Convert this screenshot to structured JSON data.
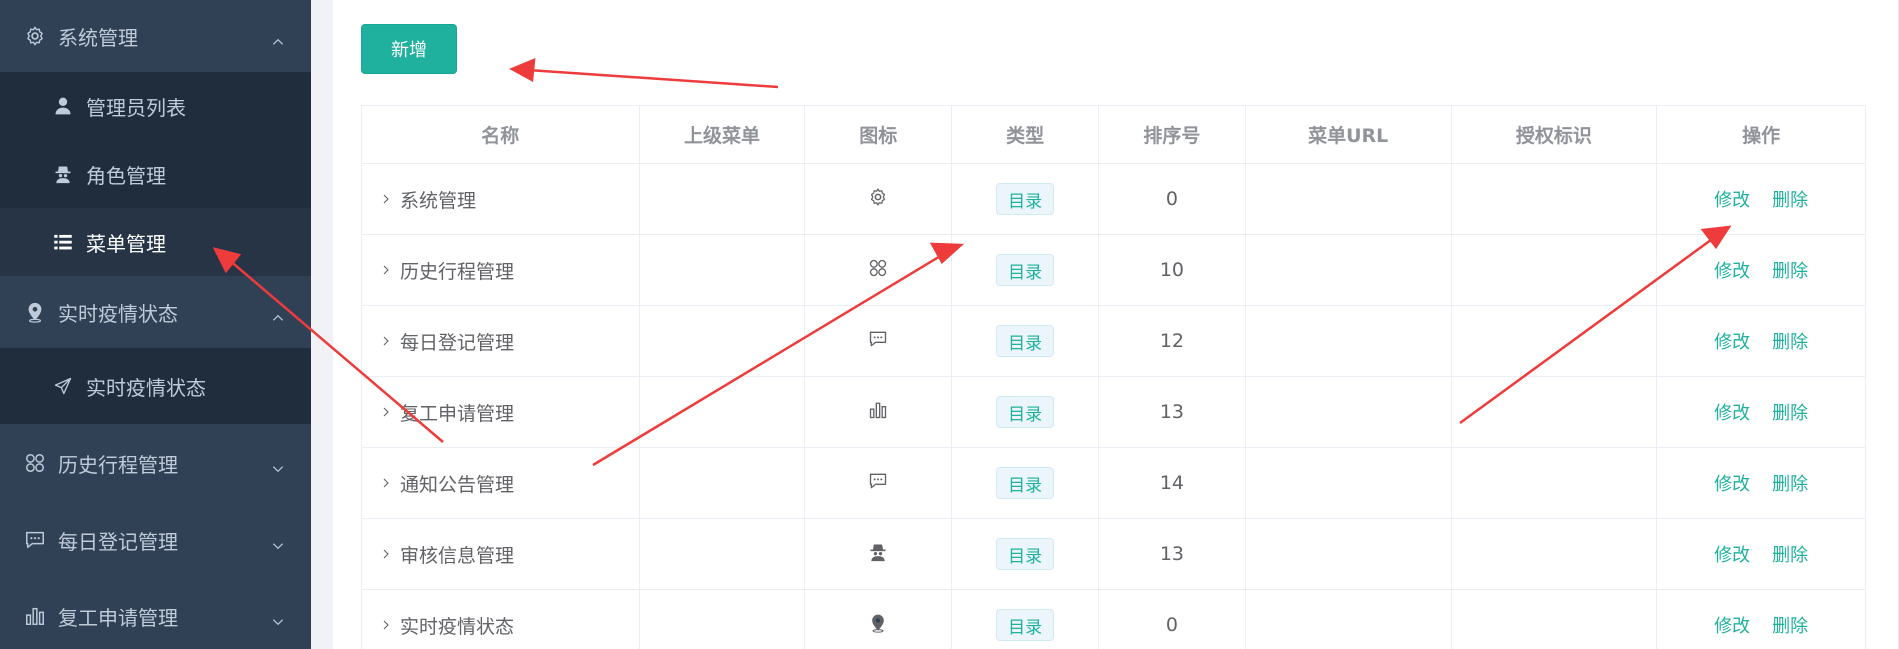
{
  "sidebar": {
    "groups": [
      {
        "label": "系统管理",
        "icon": "gear-icon",
        "expanded": true,
        "children": [
          {
            "label": "管理员列表",
            "icon": "user-icon"
          },
          {
            "label": "角色管理",
            "icon": "spy-icon"
          },
          {
            "label": "菜单管理",
            "icon": "list-icon",
            "active": true
          }
        ]
      },
      {
        "label": "实时疫情状态",
        "icon": "location-icon",
        "expanded": true,
        "children": [
          {
            "label": "实时疫情状态",
            "icon": "send-icon"
          }
        ]
      },
      {
        "label": "历史行程管理",
        "icon": "grid-icon",
        "expanded": false
      },
      {
        "label": "每日登记管理",
        "icon": "chat-icon",
        "expanded": false
      },
      {
        "label": "复工申请管理",
        "icon": "bar-chart-icon",
        "expanded": false
      }
    ]
  },
  "toolbar": {
    "add_label": "新增"
  },
  "table": {
    "headers": [
      "名称",
      "上级菜单",
      "图标",
      "类型",
      "排序号",
      "菜单URL",
      "授权标识",
      "操作"
    ],
    "rows": [
      {
        "name": "系统管理",
        "parent": "",
        "icon": "gear-icon",
        "type": "目录",
        "order": "0",
        "url": "",
        "perm": ""
      },
      {
        "name": "历史行程管理",
        "parent": "",
        "icon": "grid-icon",
        "type": "目录",
        "order": "10",
        "url": "",
        "perm": ""
      },
      {
        "name": "每日登记管理",
        "parent": "",
        "icon": "chat-icon",
        "type": "目录",
        "order": "12",
        "url": "",
        "perm": ""
      },
      {
        "name": "复工申请管理",
        "parent": "",
        "icon": "bar-chart-icon",
        "type": "目录",
        "order": "13",
        "url": "",
        "perm": ""
      },
      {
        "name": "通知公告管理",
        "parent": "",
        "icon": "chat-icon",
        "type": "目录",
        "order": "14",
        "url": "",
        "perm": ""
      },
      {
        "name": "审核信息管理",
        "parent": "",
        "icon": "spy-icon",
        "type": "目录",
        "order": "13",
        "url": "",
        "perm": ""
      },
      {
        "name": "实时疫情状态",
        "parent": "",
        "icon": "location-icon",
        "type": "目录",
        "order": "0",
        "url": "",
        "perm": ""
      }
    ],
    "edit_label": "修改",
    "delete_label": "删除"
  },
  "colors": {
    "accent": "#1fb19e",
    "sidebar_bg": "#304156",
    "annotation": "#ee3b3b"
  }
}
